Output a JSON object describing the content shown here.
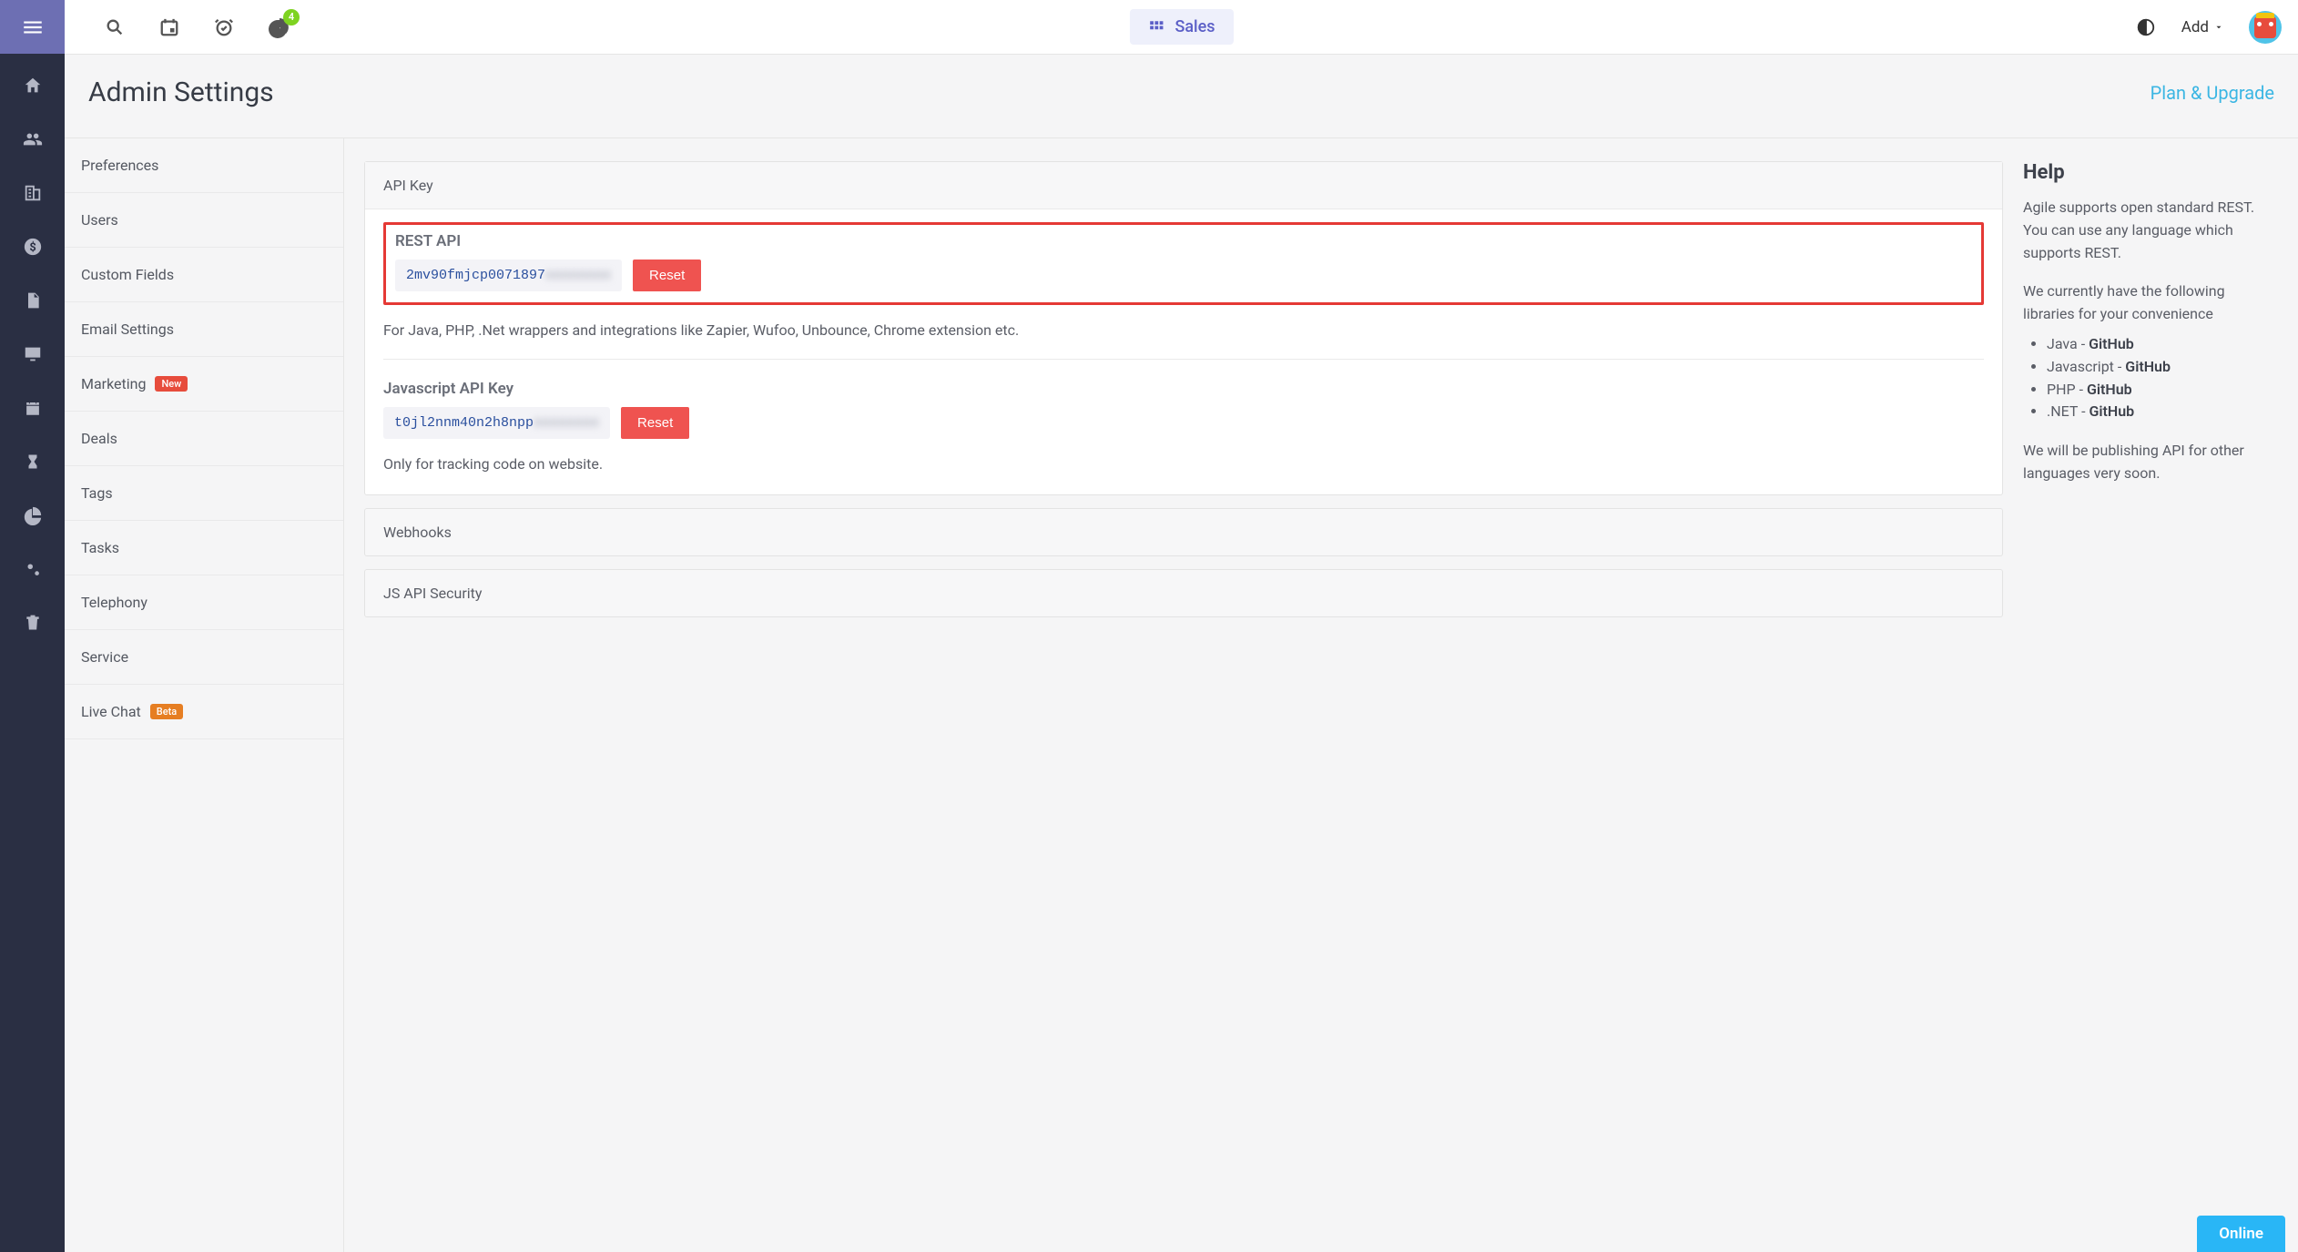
{
  "topbar": {
    "chart_badge": "4",
    "center_label": "Sales",
    "add_label": "Add"
  },
  "page": {
    "title": "Admin Settings",
    "plan_link": "Plan & Upgrade"
  },
  "sidenav": {
    "items": [
      {
        "label": "Preferences"
      },
      {
        "label": "Users"
      },
      {
        "label": "Custom Fields"
      },
      {
        "label": "Email Settings"
      },
      {
        "label": "Marketing",
        "pill": "New",
        "pill_class": "pill-red"
      },
      {
        "label": "Deals"
      },
      {
        "label": "Tags"
      },
      {
        "label": "Tasks"
      },
      {
        "label": "Telephony"
      },
      {
        "label": "Service"
      },
      {
        "label": "Live Chat",
        "pill": "Beta",
        "pill_class": "pill-orange"
      }
    ]
  },
  "api": {
    "panel_title": "API Key",
    "rest_label": "REST API",
    "rest_key_visible": "2mv90fmjcp0071897",
    "rest_key_hidden": "xxxxxxxx",
    "rest_reset": "Reset",
    "rest_desc": "For Java, PHP, .Net wrappers and integrations like Zapier, Wufoo, Unbounce, Chrome extension etc.",
    "js_label": "Javascript API Key",
    "js_key_visible": "t0jl2nnm40n2h8npp",
    "js_key_hidden": "xxxxxxxx",
    "js_reset": "Reset",
    "js_desc": "Only for tracking code on website.",
    "webhooks_title": "Webhooks",
    "jsapi_sec_title": "JS API Security"
  },
  "help": {
    "title": "Help",
    "p1": "Agile supports open standard REST. You can use any language which supports REST.",
    "p2": "We currently have the following libraries for your convenience",
    "libs": [
      {
        "name": "Java",
        "link": "GitHub"
      },
      {
        "name": "Javascript",
        "link": "GitHub"
      },
      {
        "name": "PHP",
        "link": "GitHub"
      },
      {
        "name": ".NET",
        "link": "GitHub"
      }
    ],
    "p3": "We will be publishing API for other languages very soon."
  },
  "online": "Online"
}
